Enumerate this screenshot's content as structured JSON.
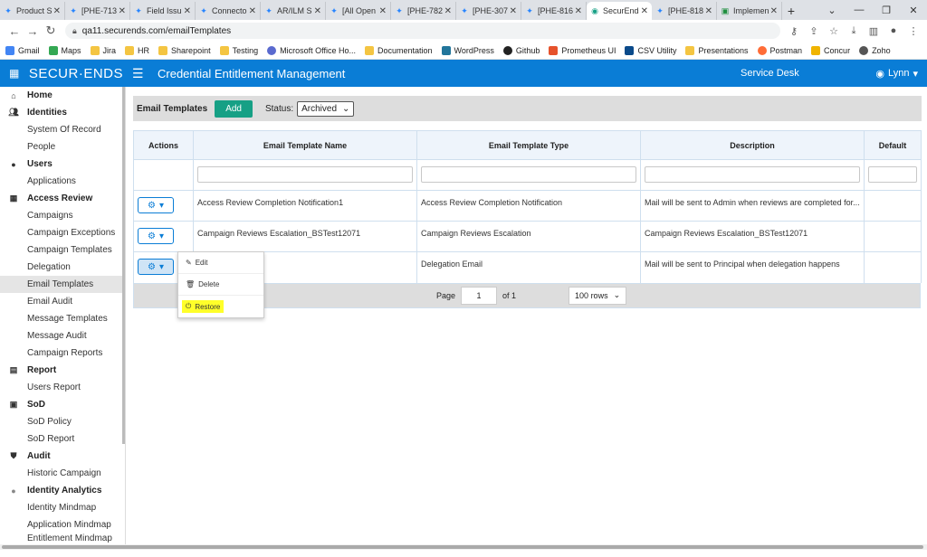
{
  "browser": {
    "tabs": [
      {
        "label": "Product S",
        "active": false
      },
      {
        "label": "[PHE-713",
        "active": false
      },
      {
        "label": "Field Issu",
        "active": false
      },
      {
        "label": "Connecto",
        "active": false
      },
      {
        "label": "AR/ILM S",
        "active": false
      },
      {
        "label": "[All Open",
        "active": false
      },
      {
        "label": "[PHE-782",
        "active": false
      },
      {
        "label": "[PHE-307",
        "active": false
      },
      {
        "label": "[PHE-816",
        "active": false
      },
      {
        "label": "SecurEnds",
        "active": true
      },
      {
        "label": "[PHE-818",
        "active": false
      },
      {
        "label": "Implemen",
        "active": false
      }
    ],
    "url": "qa11.securends.com/emailTemplates",
    "bookmarks": [
      "Gmail",
      "Maps",
      "Jira",
      "HR",
      "Sharepoint",
      "Testing",
      "Microsoft Office Ho...",
      "Documentation",
      "WordPress",
      "Github",
      "Prometheus UI",
      "CSV Utility",
      "Presentations",
      "Postman",
      "Concur",
      "Zoho"
    ]
  },
  "header": {
    "logo": "SECUR·ENDS",
    "title": "Credential Entitlement Management",
    "service_desk": "Service Desk",
    "user": "Lynn"
  },
  "sidebar": {
    "home": "Home",
    "identities": "Identities",
    "system_of_record": "System Of Record",
    "people": "People",
    "users": "Users",
    "applications": "Applications",
    "access_review": "Access Review",
    "campaigns": "Campaigns",
    "campaign_exceptions": "Campaign Exceptions",
    "campaign_templates": "Campaign Templates",
    "delegation": "Delegation",
    "email_templates": "Email Templates",
    "email_audit": "Email Audit",
    "message_templates": "Message Templates",
    "message_audit": "Message Audit",
    "campaign_reports": "Campaign Reports",
    "report": "Report",
    "users_report": "Users Report",
    "sod": "SoD",
    "sod_policy": "SoD Policy",
    "sod_report": "SoD Report",
    "audit": "Audit",
    "historic_campaign": "Historic Campaign",
    "identity_analytics": "Identity Analytics",
    "identity_mindmap": "Identity Mindmap",
    "application_mindmap": "Application Mindmap",
    "entitlement_mindmap": "Entitlement Mindmap"
  },
  "toolbar": {
    "title": "Email Templates",
    "add_label": "Add",
    "status_label": "Status:",
    "status_value": "Archived"
  },
  "table": {
    "headers": {
      "actions": "Actions",
      "name": "Email Template Name",
      "type": "Email Template Type",
      "description": "Description",
      "default": "Default"
    },
    "rows": [
      {
        "name": "Access Review Completion Notification1",
        "type": "Access Review Completion Notification",
        "description": "Mail will be sent to Admin when reviews are completed for...",
        "default": ""
      },
      {
        "name": "Campaign Reviews Escalation_BSTest12071",
        "type": "Campaign Reviews Escalation",
        "description": "Campaign Reviews Escalation_BSTest12071",
        "default": ""
      },
      {
        "name": "",
        "type": "Delegation Email",
        "description": "Mail will be sent to Principal when delegation happens",
        "default": ""
      }
    ]
  },
  "pager": {
    "page_label": "Page",
    "page_value": "1",
    "of_label": "of 1",
    "rows_value": "100 rows"
  },
  "action_menu": {
    "edit": "Edit",
    "delete": "Delete",
    "restore": "Restore"
  },
  "colors": {
    "brand": "#0a7dd6",
    "add_button": "#16a085",
    "highlight": "#ffff2a"
  }
}
